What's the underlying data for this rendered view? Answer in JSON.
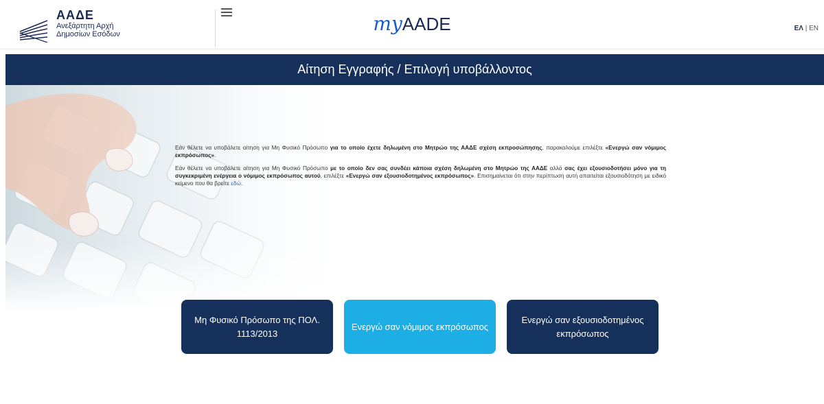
{
  "header": {
    "logo_title": "ΑΑΔΕ",
    "logo_sub_1": "Ανεξάρτητη Αρχή",
    "logo_sub_2": "Δημοσίων Εσόδων",
    "brand_my": "my",
    "brand_name": "AADE",
    "lang_el": "ΕΛ",
    "lang_sep": " | ",
    "lang_en": "EN",
    "menu_icon": "hamburger-icon"
  },
  "page": {
    "title": "Αίτηση Εγγραφής / Επιλογή υποβάλλοντος"
  },
  "content": {
    "p1": {
      "t1": "Εάν θέλετε να υποβάλετε αίτηση για Μη Φυσικό Πρόσωπο ",
      "b1": "για το οποίο έχετε δηλωμένη στο Μητρώο της ΑΑΔΕ σχέση εκπροσώπησης",
      "t2": ", παρακαλούμε επιλέξτε ",
      "b2": "«Ενεργώ σαν νόμιμος εκπρόσωπος»",
      "t3": "."
    },
    "p2": {
      "t1": "Εάν θέλετε να υποβάλετε αίτηση για Μη Φυσικό Πρόσωπο ",
      "b1": "με το οποίο δεν σας συνδέει κάποια σχέση δηλωμένη στο Μητρώο της ΑΑΔΕ",
      "t2": " αλλά ",
      "b2": "σας έχει εξουσιοδοτήσει μόνο για τη συγκεκριμένη ενέργεια ο νόμιμος εκπρόσωπος αυτού",
      "t3": ", επιλέξτε ",
      "b3": "«Ενεργώ σαν εξουσιοδοτημένος εκπρόσωπος»",
      "t4": ". Επισημαίνεται ότι στην περίπτωση αυτή απαιτείται εξουσιοδότηση με ειδικό κείμενο που θα βρείτε ",
      "link": "εδώ",
      "t5": "."
    }
  },
  "buttons": {
    "b1": "Μη Φυσικό Πρόσωπο της ΠΟΛ. 1113/2013",
    "b2": "Ενεργώ σαν νόμιμος εκπρόσωπος",
    "b3": "Ενεργώ σαν εξουσιοδοτημένος εκπρόσωπος"
  },
  "colors": {
    "navy": "#16305c",
    "light_blue": "#1eaee6",
    "link": "#2270d0"
  }
}
